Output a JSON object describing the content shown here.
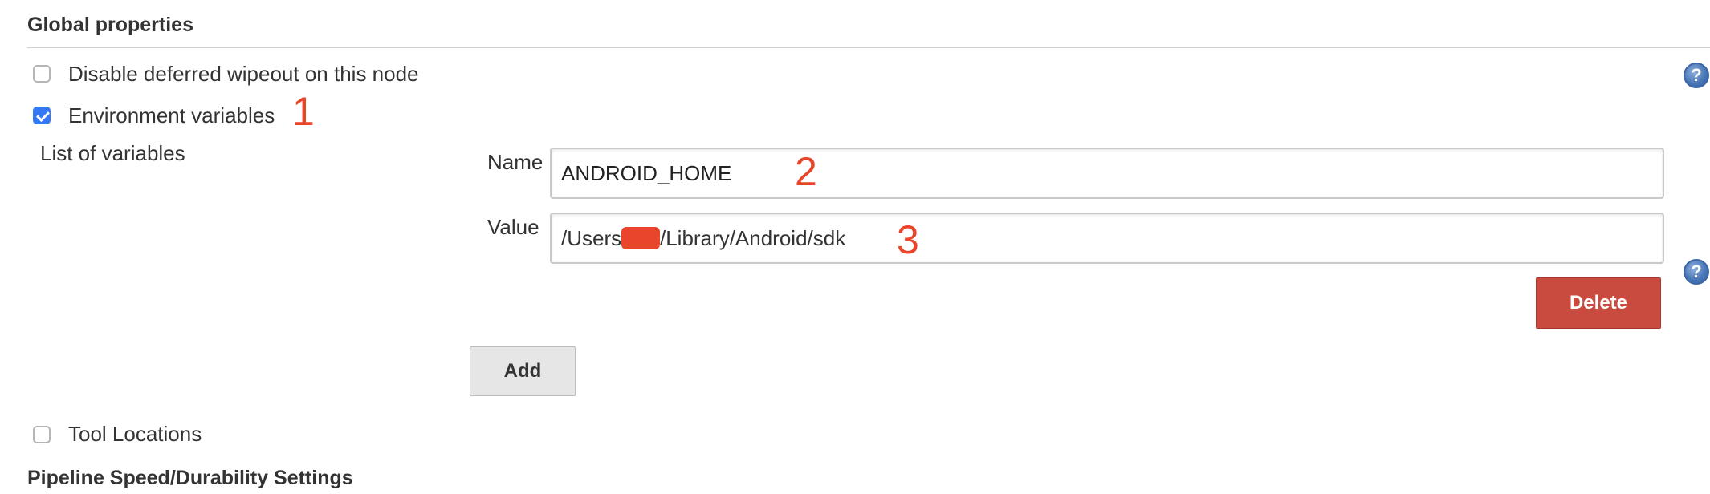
{
  "global_properties": {
    "title": "Global properties",
    "options": [
      {
        "label": "Disable deferred wipeout on this node",
        "checked": false
      },
      {
        "label": "Environment variables",
        "checked": true
      }
    ]
  },
  "env_vars": {
    "list_label": "List of variables",
    "entry": {
      "name_label": "Name",
      "name_value": "ANDROID_HOME",
      "value_label": "Value",
      "value_prefix": "/Users/",
      "value_suffix": "/Library/Android/sdk"
    },
    "delete_label": "Delete",
    "add_label": "Add"
  },
  "tool_locations": {
    "label": "Tool Locations",
    "checked": false
  },
  "pipeline": {
    "title": "Pipeline Speed/Durability Settings"
  },
  "annotations": {
    "one": "1",
    "two": "2",
    "three": "3"
  },
  "help": {
    "glyph": "?"
  },
  "colors": {
    "annotation": "#e8452b",
    "checkbox_checked": "#3478f6",
    "delete_button": "#c94b3f",
    "add_button": "#e6e6e6",
    "help_icon": "#4a78b8"
  }
}
